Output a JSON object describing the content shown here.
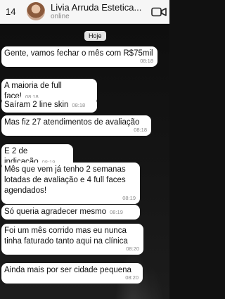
{
  "header": {
    "back_count": "14",
    "contact_name": "Livia Arruda Estetica...",
    "status": "online",
    "video_icon": "video-camera-icon"
  },
  "chat": {
    "date_chip": "Hoje",
    "messages": [
      {
        "text": "Gente, vamos fechar o mês com R$75mil",
        "time": "08:18"
      },
      {
        "text": "A maioria de full face!",
        "time": "08:18"
      },
      {
        "text": "Saíram 2 line skin",
        "time": "08:18"
      },
      {
        "text": "Mas fiz 27 atendimentos de avaliação",
        "time": "08:18"
      },
      {
        "text": "E 2 de indicação",
        "time": "08:19"
      },
      {
        "text": "Mês que vem já tenho 2 semanas lotadas de avaliação e 4 full faces agendados!",
        "time": "08:19"
      },
      {
        "text": "Só queria agradecer mesmo",
        "time": "08:19"
      },
      {
        "text": "Foi um mês corrido mas eu nunca tinha faturado tanto aqui na clínica",
        "time": "08:20"
      },
      {
        "text": "Ainda mais por ser cidade pequena",
        "time": "08:20"
      }
    ]
  }
}
